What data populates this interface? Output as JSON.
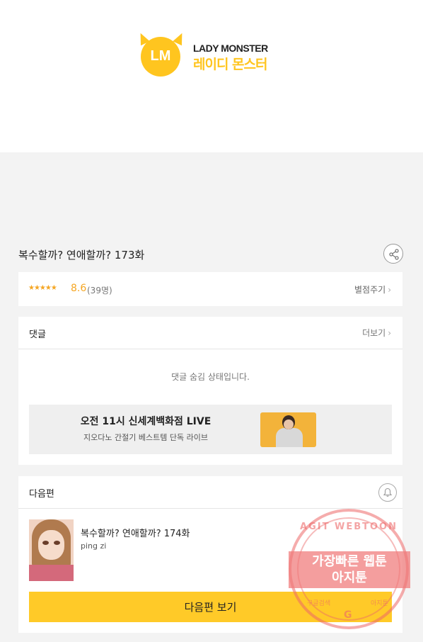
{
  "brand": {
    "logo_mark": "LM",
    "name_en": "LADY MONSTER",
    "name_ko": "레이디 몬스터"
  },
  "episode": {
    "title": "복수할까? 연애할까? 173화",
    "share_icon": "share-icon"
  },
  "rating": {
    "stars": "★★★★★",
    "score": "8.6",
    "count": "(39명)",
    "rate_label": "별점주기"
  },
  "comments": {
    "title": "댓글",
    "more_label": "더보기",
    "hidden_message": "댓글 숨김 상태입니다."
  },
  "ad": {
    "title": "오전 11시 신세계백화점 LIVE",
    "subtitle": "지오다노 간절기 베스트템 단독 라이브"
  },
  "next_episode": {
    "section_title": "다음편",
    "bell_icon": "bell-icon",
    "title": "복수할까? 연애할까? 174화",
    "author": "ping zi",
    "button_label": "다음편 보기"
  },
  "watermark": {
    "arc_text": "AGIT WEBTOON",
    "line1": "가장빠른 웹툰",
    "line2": "아지툰",
    "bottom_left": "구글검색",
    "bottom_right": "아지툰",
    "g_mark": "G"
  },
  "colors": {
    "accent": "#ffca28",
    "star": "#f5a623",
    "stamp": "#ec6868"
  }
}
